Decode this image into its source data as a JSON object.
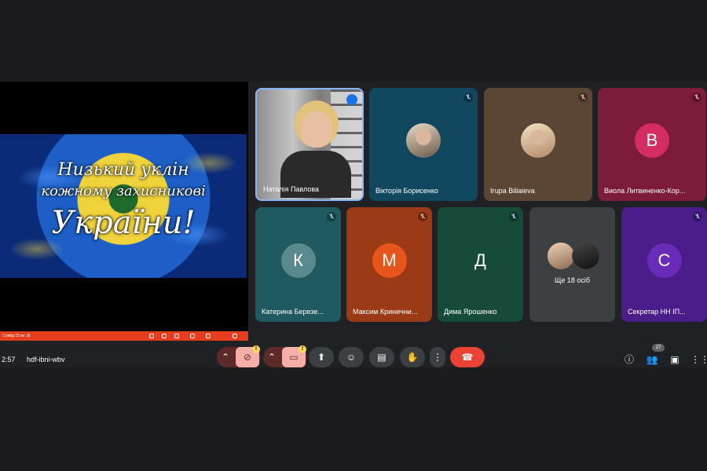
{
  "slide": {
    "line1": "Низький уклін",
    "line2": "кожному захисникові",
    "line3": "України!",
    "footer_label": "Слайд 15 из 16"
  },
  "participants": [
    {
      "name": "Наталія Павлова",
      "type": "video"
    },
    {
      "name": "Вікторія Борисенко",
      "type": "photo",
      "color": "#12485f"
    },
    {
      "name": "Ігupa Biliaieva",
      "type": "photo",
      "color": "#5b4534"
    },
    {
      "name": "Виола Литвиненко-Кор...",
      "type": "letter",
      "letter": "В",
      "color": "#7d1c3a",
      "avatar_color": "#d32d62"
    },
    {
      "name": "Катерина Березе...",
      "type": "letter",
      "letter": "К",
      "color": "#1e5a5f",
      "avatar_color": "#5a8a8e"
    },
    {
      "name": "Максим Кринични...",
      "type": "letter",
      "letter": "М",
      "color": "#9b3a16",
      "avatar_color": "#e8551c"
    },
    {
      "name": "Дима Ярошенко",
      "type": "letter",
      "letter": "Д",
      "color": "#164b3a",
      "avatar_color": "#164b3a"
    },
    {
      "name": "Секретар НН ІП...",
      "type": "letter",
      "letter": "С",
      "color": "#4a1d8a",
      "avatar_color": "#6a2bb8"
    }
  ],
  "more_tile": {
    "label": "Ще 18 осіб"
  },
  "toolbar": {
    "time": "2:57",
    "meeting_code": "hdf-ibni-wbv",
    "participants_count": "27"
  },
  "icons": {
    "mic_off": "mic-off-icon",
    "cam_off": "camera-off-icon",
    "present": "present-icon",
    "emoji": "emoji-icon",
    "captions": "captions-icon",
    "raise_hand": "hand-icon",
    "more": "more-vert-icon",
    "end_call": "phone-hangup-icon",
    "info": "info-icon",
    "people": "people-icon",
    "chat": "chat-icon",
    "activities": "apps-icon"
  }
}
